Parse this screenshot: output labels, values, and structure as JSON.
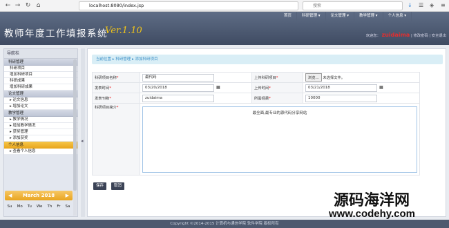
{
  "browser": {
    "url": "localhost:8080/index.jsp",
    "search_placeholder": "搜索"
  },
  "header": {
    "title": "教师年度工作填报系统",
    "version": "Ver.1.10",
    "nav": [
      "首页",
      "科研管理 ▾",
      "论文管理 ▾",
      "教学管理 ▾",
      "个人信息 ▾"
    ],
    "welcome": "欢迎您：",
    "username": "zuidaima",
    "change_pwd": "修改密码",
    "logout": "安全退出"
  },
  "sidebar": {
    "title": "导航栏",
    "groups": [
      {
        "label": "科研管理",
        "items": [
          "科研项目",
          "增加科研项目",
          "科研成果",
          "增加科研成果"
        ]
      },
      {
        "label": "论文管理",
        "items": [
          "▸ 论文信息",
          "▸ 增加论文"
        ]
      },
      {
        "label": "教学管理",
        "items": [
          "▸ 教学情况",
          "▸ 增加教学情况",
          "▸ 获奖管理",
          "▸ 添加获奖"
        ]
      }
    ],
    "personal": {
      "label": "个人信息",
      "items": [
        "▸ 查看个人信息"
      ]
    },
    "calendar": {
      "month": "March 2018",
      "days": [
        "Su",
        "Mo",
        "Tu",
        "We",
        "Th",
        "Fr",
        "Sa"
      ]
    }
  },
  "breadcrumb": [
    "当前位置 ▸",
    "科研管理 ▸",
    "添加科研项目"
  ],
  "form": {
    "name_label": "科研项目名称",
    "name_value": "最代码",
    "upload_label": "上传科研项目",
    "browse": "浏览...",
    "no_file": "未选择文件。",
    "publish_label": "发表时间",
    "publish_value": "03/20/2018",
    "upload_time_label": "上传时间",
    "upload_time_value": "03/21/2018",
    "journal_label": "发表刊物",
    "journal_value": "zuidaima",
    "funding_label": "所需经费",
    "funding_value": "10000",
    "intro_label": "科研项目简介",
    "intro_value": "最全面,最专业的源代码分享网站"
  },
  "buttons": {
    "save": "保存",
    "cancel": "取消"
  },
  "footer": "Copyright ©2014-2015 计算机与通信学院 软件学院 版权所有",
  "watermark": {
    "line1": "源码海洋网",
    "line2": "www.codehy.com"
  }
}
